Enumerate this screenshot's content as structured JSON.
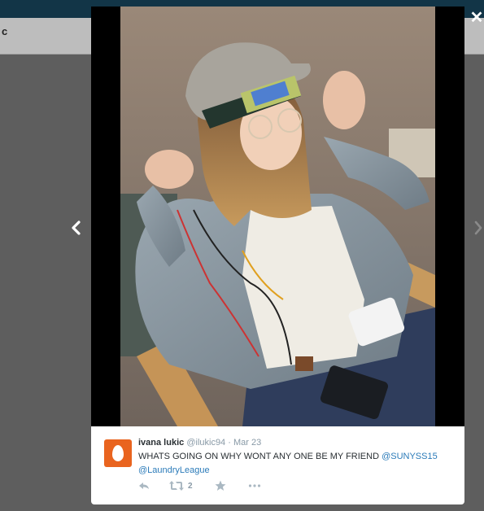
{
  "background": {
    "page_title": "c"
  },
  "close_glyph": "✕",
  "tweet": {
    "name": "ivana lukic",
    "handle": "@ilukic94",
    "separator": "·",
    "date": "Mar 23",
    "text": "WHATS GOING ON WHY WONT ANY ONE BE MY FRIEND ",
    "mention_1": "@SUNYSS15",
    "mention_2": "@LaundryLeague",
    "retweet_count": "2"
  },
  "icons": {
    "close": "close-icon",
    "prev": "chevron-left-icon",
    "next": "chevron-right-icon",
    "reply": "reply-icon",
    "retweet": "retweet-icon",
    "favorite": "star-icon",
    "more": "more-icon",
    "avatar": "egg-avatar-icon"
  },
  "colors": {
    "avatar_bg": "#e9641f",
    "link": "#2b7bb9",
    "top_bar": "#123547"
  }
}
